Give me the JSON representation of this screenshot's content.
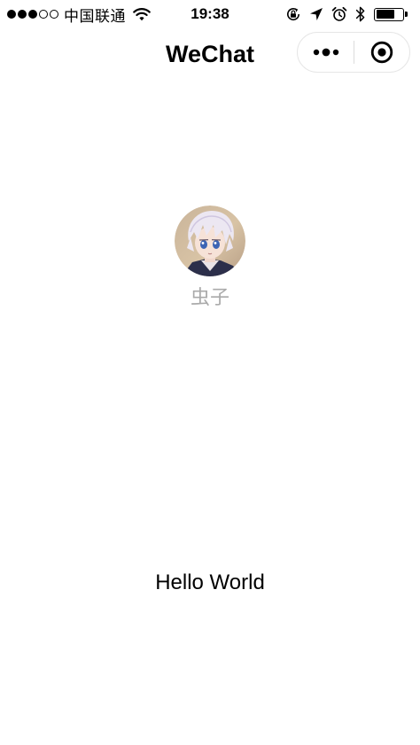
{
  "status_bar": {
    "carrier": "中国联通",
    "time": "19:38",
    "signal_strength": 3,
    "signal_max": 5,
    "battery_level_fraction": 0.7,
    "icons": [
      "wifi-icon",
      "rotation-lock-icon",
      "location-arrow-icon",
      "alarm-icon",
      "bluetooth-icon",
      "battery-icon"
    ]
  },
  "nav_bar": {
    "title": "WeChat",
    "capsule": {
      "more_icon": "more-dots-icon",
      "close_icon": "target-circle-icon"
    }
  },
  "userinfo": {
    "avatar_icon": "anime-avatar",
    "nickname": "虫子"
  },
  "motto": "Hello World",
  "colors": {
    "background": "#ffffff",
    "nickname": "#aaaaaa",
    "text": "#000000",
    "capsule_border": "#e6e6e6"
  }
}
